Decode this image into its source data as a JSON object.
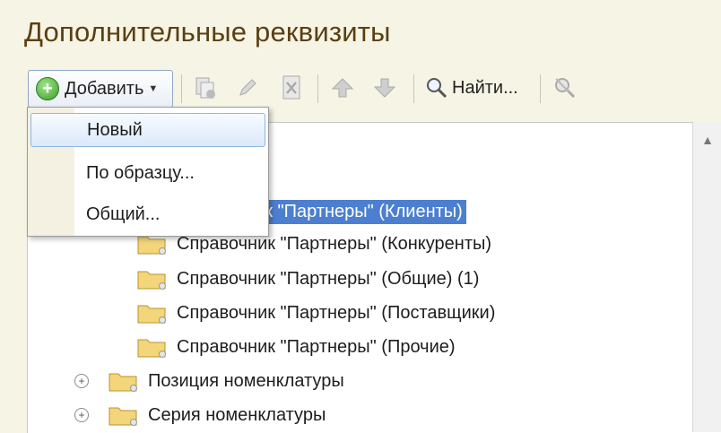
{
  "header": {
    "title": "Дополнительные реквизиты"
  },
  "toolbar": {
    "add_label": "Добавить",
    "find_label": "Найти...",
    "icons": [
      "add-icon",
      "copy-icon",
      "edit-icon",
      "delete-mark-icon",
      "move-up-icon",
      "move-down-icon",
      "find-icon",
      "clear-search-icon"
    ]
  },
  "menu": {
    "items": [
      {
        "label": "Новый"
      },
      {
        "label": "По образцу..."
      },
      {
        "label": "Общий..."
      }
    ]
  },
  "tree": {
    "selected_partial": "ник \"Партнеры\" (Клиенты)",
    "items": [
      {
        "label": "Справочник \"Партнеры\" (Конкуренты)"
      },
      {
        "label": "Справочник \"Партнеры\" (Общие) (1)"
      },
      {
        "label": "Справочник \"Партнеры\" (Поставщики)"
      },
      {
        "label": "Справочник \"Партнеры\" (Прочие)"
      },
      {
        "label": "Позиция номенклатуры"
      },
      {
        "label": "Серия номенклатуры"
      }
    ]
  },
  "colors": {
    "selection": "#4c7fcf",
    "background": "#f6f4e4",
    "title": "#5a3f12"
  }
}
